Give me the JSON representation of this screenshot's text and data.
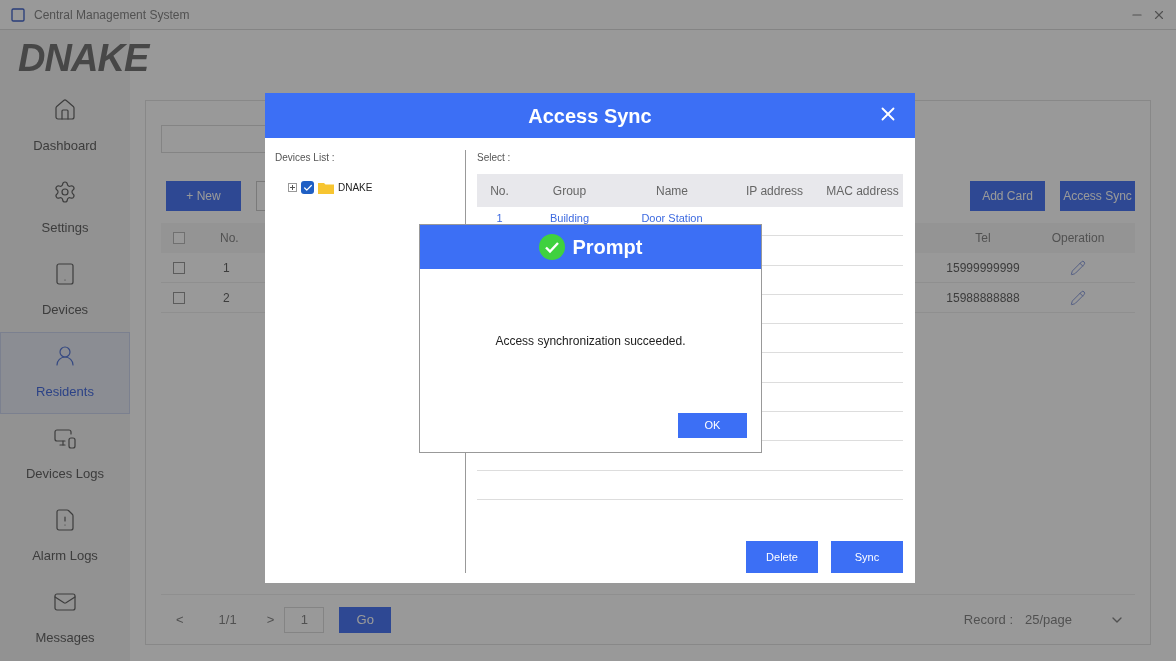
{
  "window": {
    "title": "Central Management System"
  },
  "logo": "DNAKE",
  "sidebar": {
    "items": [
      {
        "label": "Dashboard",
        "selected": false
      },
      {
        "label": "Settings",
        "selected": false
      },
      {
        "label": "Devices",
        "selected": false
      },
      {
        "label": "Residents",
        "selected": true
      },
      {
        "label": "Devices Logs",
        "selected": false
      },
      {
        "label": "Alarm Logs",
        "selected": false
      },
      {
        "label": "Messages",
        "selected": false
      }
    ]
  },
  "residents": {
    "new_button": "+ New",
    "add_card_button": "Add Card",
    "access_sync_button": "Access Sync",
    "table": {
      "header_checked": false,
      "columns": [
        "No.",
        "Tel",
        "Operation"
      ],
      "rows": [
        {
          "no": "1",
          "tel": "15999999999",
          "checked": false
        },
        {
          "no": "2",
          "tel": "15988888888",
          "checked": false
        }
      ]
    },
    "pagination": {
      "prev": "<",
      "page": "1/1",
      "next": ">",
      "page_input": "1",
      "go": "Go",
      "record_label": "Record :",
      "page_size": "25/page"
    }
  },
  "access_sync": {
    "title": "Access Sync",
    "devices_list_label": "Devices List :",
    "tree": [
      {
        "label": "DNAKE",
        "checked": true,
        "expanded": false
      }
    ],
    "select_label": "Select :",
    "table": {
      "columns": [
        "No.",
        "Group",
        "Name",
        "IP address",
        "MAC address"
      ],
      "rows": [
        {
          "no": "1",
          "group": "Building",
          "name": "Door Station"
        }
      ]
    },
    "buttons": [
      "Delete",
      "Sync"
    ]
  },
  "prompt": {
    "title": "Prompt",
    "message": "Access synchronization succeeded.",
    "ok": "OK"
  }
}
